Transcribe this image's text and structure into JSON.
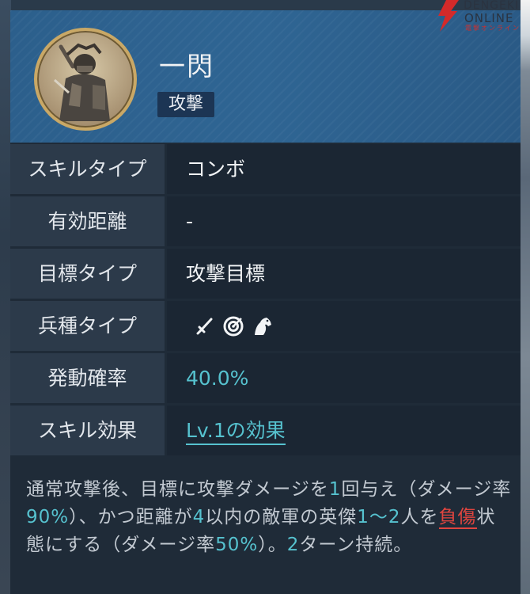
{
  "header": {
    "skill_name": "一閃",
    "skill_category": "攻撃",
    "portrait_icon": "samurai-portrait-icon"
  },
  "watermark": {
    "line1": "DENGEKI",
    "line2": "ONLINE",
    "line3": "電撃オンライン",
    "accent_color": "#d42a2a"
  },
  "rows": [
    {
      "label": "スキルタイプ",
      "value": "コンボ"
    },
    {
      "label": "有効距離",
      "value": "-"
    },
    {
      "label": "目標タイプ",
      "value": "攻撃目標"
    },
    {
      "label": "兵種タイプ",
      "icons": [
        "sword-icon",
        "target-icon",
        "horse-icon"
      ]
    },
    {
      "label": "発動確率",
      "value": "40.0%"
    },
    {
      "label": "スキル効果",
      "value": "Lv.1の効果"
    }
  ],
  "description": {
    "s1": "通常攻撃後、目標に攻撃ダメージを",
    "n1": "1",
    "s2": "回与え（ダメージ率",
    "n2": "90%",
    "s3": "）、かつ距離が",
    "n3": "4",
    "s4": "以内の敵軍の英傑",
    "n4": "1～2",
    "s5": "人を",
    "status": "負傷",
    "s6": "状態にする（ダメージ率",
    "n5": "50%",
    "s7": "）。",
    "n6": "2",
    "s8": "ターン持続。"
  },
  "colors": {
    "accent_teal": "#56c2cf",
    "status_red": "#e0453f",
    "header_blue": "#2f6593"
  }
}
